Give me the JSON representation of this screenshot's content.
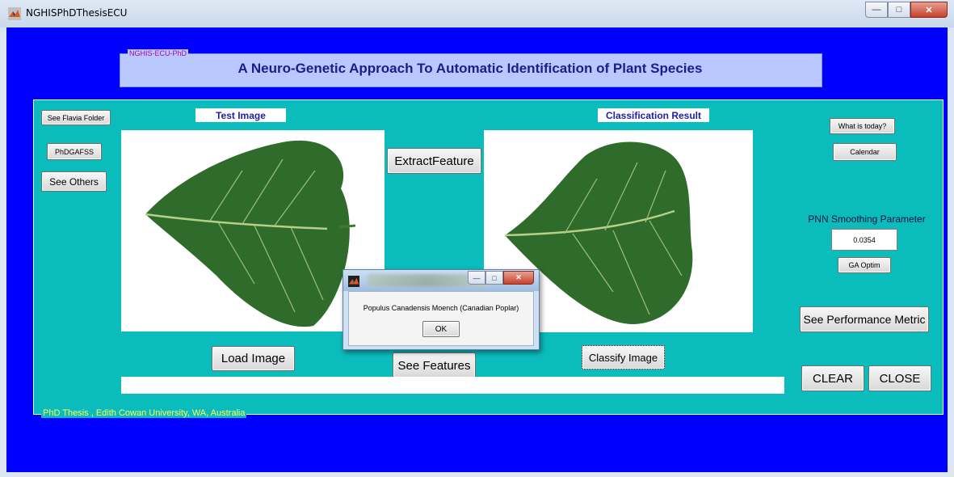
{
  "window": {
    "title": "NGHISPhDThesisECU",
    "minimize_glyph": "—",
    "maximize_glyph": "□",
    "close_glyph": "✕"
  },
  "header": {
    "tag": "NGHIS-ECU-PhD",
    "title": "A Neuro-Genetic Approach To Automatic Identification of Plant Species"
  },
  "left_buttons": {
    "see_flavia": "See Flavia Folder",
    "phdgafss": "PhDGAFSS",
    "see_others": "See Others"
  },
  "test_image": {
    "label": "Test Image",
    "load_button": "Load Image"
  },
  "middle": {
    "extract_button": "ExtractFeature",
    "see_features_button": "See Features"
  },
  "result_image": {
    "label": "Classification Result",
    "classify_button": "Classify Image"
  },
  "right_panel": {
    "today_button": "What is today?",
    "calendar_button": "Calendar",
    "pnn_label": "PNN Smoothing Parameter",
    "pnn_value": "0.0354",
    "ga_button": "GA Optim",
    "metric_button": "See Performance Metric",
    "clear_button": "CLEAR",
    "close_button": "CLOSE"
  },
  "footer": {
    "tag": "PhD Thesis , Edith Cowan University, WA, Australia"
  },
  "dialog": {
    "message": "Populus Canadensis Moench (Canadian Poplar)",
    "ok_button": "OK"
  },
  "colors": {
    "background": "#0000ff",
    "panel": "#0bbcbc",
    "header_panel": "#b9c9ff",
    "leaf": "#2f6b2a"
  }
}
